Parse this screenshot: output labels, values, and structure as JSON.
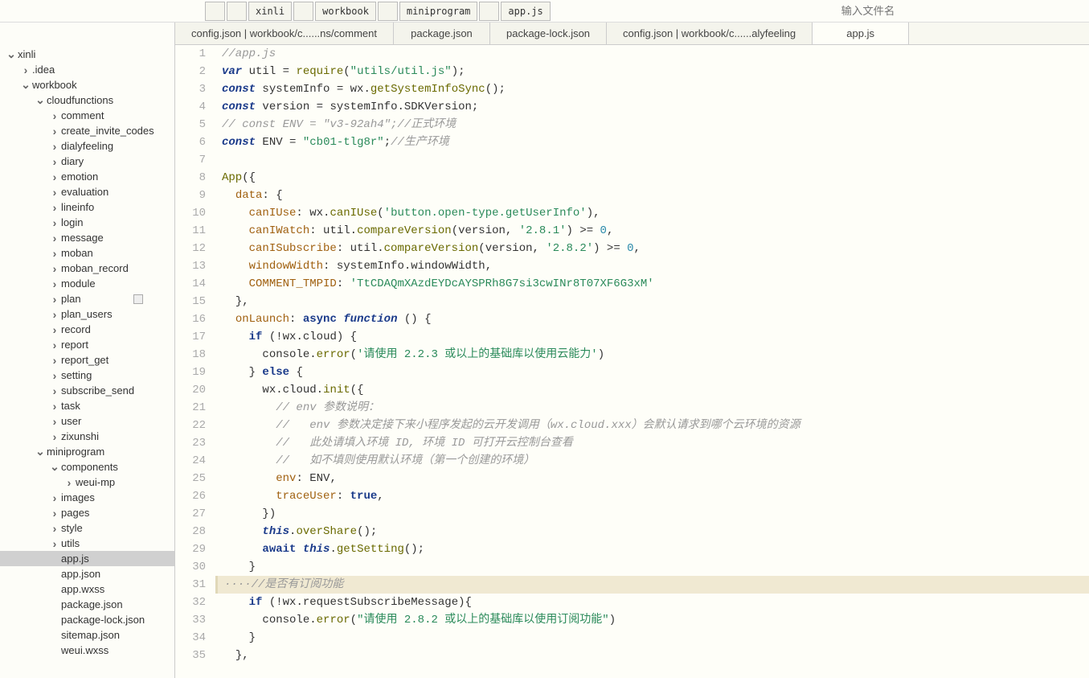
{
  "breadcrumbs": [
    {
      "label": ""
    },
    {
      "label": ""
    },
    {
      "label": "xinli"
    },
    {
      "label": ""
    },
    {
      "label": "workbook"
    },
    {
      "label": ""
    },
    {
      "label": "miniprogram"
    },
    {
      "label": ""
    },
    {
      "label": "app.js"
    }
  ],
  "search_placeholder": "输入文件名",
  "tabs": [
    {
      "label": "config.json | workbook/c......ns/comment",
      "active": false
    },
    {
      "label": "package.json",
      "active": false
    },
    {
      "label": "package-lock.json",
      "active": false
    },
    {
      "label": "config.json | workbook/c......alyfeeling",
      "active": false
    },
    {
      "label": "app.js",
      "active": true
    }
  ],
  "tree": [
    {
      "label": "xinli",
      "depth": 0,
      "arrow": "expanded"
    },
    {
      "label": ".idea",
      "depth": 1,
      "arrow": "collapsed"
    },
    {
      "label": "workbook",
      "depth": 1,
      "arrow": "expanded"
    },
    {
      "label": "cloudfunctions",
      "depth": 2,
      "arrow": "expanded"
    },
    {
      "label": "comment",
      "depth": 3,
      "arrow": "collapsed"
    },
    {
      "label": "create_invite_codes",
      "depth": 3,
      "arrow": "collapsed"
    },
    {
      "label": "dialyfeeling",
      "depth": 3,
      "arrow": "collapsed"
    },
    {
      "label": "diary",
      "depth": 3,
      "arrow": "collapsed"
    },
    {
      "label": "emotion",
      "depth": 3,
      "arrow": "collapsed"
    },
    {
      "label": "evaluation",
      "depth": 3,
      "arrow": "collapsed"
    },
    {
      "label": "lineinfo",
      "depth": 3,
      "arrow": "collapsed"
    },
    {
      "label": "login",
      "depth": 3,
      "arrow": "collapsed"
    },
    {
      "label": "message",
      "depth": 3,
      "arrow": "collapsed"
    },
    {
      "label": "moban",
      "depth": 3,
      "arrow": "collapsed"
    },
    {
      "label": "moban_record",
      "depth": 3,
      "arrow": "collapsed"
    },
    {
      "label": "module",
      "depth": 3,
      "arrow": "collapsed"
    },
    {
      "label": "plan",
      "depth": 3,
      "arrow": "collapsed",
      "badge": true
    },
    {
      "label": "plan_users",
      "depth": 3,
      "arrow": "collapsed"
    },
    {
      "label": "record",
      "depth": 3,
      "arrow": "collapsed"
    },
    {
      "label": "report",
      "depth": 3,
      "arrow": "collapsed"
    },
    {
      "label": "report_get",
      "depth": 3,
      "arrow": "collapsed"
    },
    {
      "label": "setting",
      "depth": 3,
      "arrow": "collapsed"
    },
    {
      "label": "subscribe_send",
      "depth": 3,
      "arrow": "collapsed"
    },
    {
      "label": "task",
      "depth": 3,
      "arrow": "collapsed"
    },
    {
      "label": "user",
      "depth": 3,
      "arrow": "collapsed"
    },
    {
      "label": "zixunshi",
      "depth": 3,
      "arrow": "collapsed"
    },
    {
      "label": "miniprogram",
      "depth": 2,
      "arrow": "expanded"
    },
    {
      "label": "components",
      "depth": 3,
      "arrow": "expanded"
    },
    {
      "label": "weui-mp",
      "depth": 4,
      "arrow": "collapsed"
    },
    {
      "label": "images",
      "depth": 3,
      "arrow": "collapsed"
    },
    {
      "label": "pages",
      "depth": 3,
      "arrow": "collapsed"
    },
    {
      "label": "style",
      "depth": 3,
      "arrow": "collapsed"
    },
    {
      "label": "utils",
      "depth": 3,
      "arrow": "collapsed"
    },
    {
      "label": "app.js",
      "depth": 3,
      "arrow": "none",
      "selected": true
    },
    {
      "label": "app.json",
      "depth": 3,
      "arrow": "none"
    },
    {
      "label": "app.wxss",
      "depth": 3,
      "arrow": "none"
    },
    {
      "label": "package.json",
      "depth": 3,
      "arrow": "none"
    },
    {
      "label": "package-lock.json",
      "depth": 3,
      "arrow": "none"
    },
    {
      "label": "sitemap.json",
      "depth": 3,
      "arrow": "none"
    },
    {
      "label": "weui.wxss",
      "depth": 3,
      "arrow": "none"
    }
  ],
  "code": [
    {
      "n": 1,
      "html": "<span class='cm'>//app.js</span>"
    },
    {
      "n": 2,
      "html": "<span class='kw'>var</span> <span class='id'>util</span> <span class='pn'>=</span> <span class='fn'>require</span><span class='pn'>(</span><span class='str'>\"utils/util.js\"</span><span class='pn'>);</span>"
    },
    {
      "n": 3,
      "html": "<span class='kw'>const</span> <span class='id'>systemInfo</span> <span class='pn'>=</span> <span class='id'>wx</span><span class='pn'>.</span><span class='fn'>getSystemInfoSync</span><span class='pn'>();</span>"
    },
    {
      "n": 4,
      "html": "<span class='kw'>const</span> <span class='id'>version</span> <span class='pn'>=</span> <span class='id'>systemInfo</span><span class='pn'>.</span><span class='id'>SDKVersion</span><span class='pn'>;</span>"
    },
    {
      "n": 5,
      "html": "<span class='cm'>// const ENV = \"v3-92ah4\";//正式环境</span>"
    },
    {
      "n": 6,
      "html": "<span class='kw'>const</span> <span class='id'>ENV</span> <span class='pn'>=</span> <span class='str'>\"cb01-tlg8r\"</span><span class='pn'>;</span><span class='cm'>//生产环境</span>"
    },
    {
      "n": 7,
      "html": ""
    },
    {
      "n": 8,
      "html": "<span class='fn'>App</span><span class='pn'>({</span>"
    },
    {
      "n": 9,
      "html": "  <span class='prop'>data</span><span class='pn'>: {</span>"
    },
    {
      "n": 10,
      "html": "    <span class='prop'>canIUse</span><span class='pn'>:</span> <span class='id'>wx</span><span class='pn'>.</span><span class='fn'>canIUse</span><span class='pn'>(</span><span class='str'>'button.open-type.getUserInfo'</span><span class='pn'>),</span>"
    },
    {
      "n": 11,
      "html": "    <span class='prop'>canIWatch</span><span class='pn'>:</span> <span class='id'>util</span><span class='pn'>.</span><span class='fn'>compareVersion</span><span class='pn'>(</span><span class='id'>version</span><span class='pn'>,</span> <span class='str'>'2.8.1'</span><span class='pn'>) &gt;=</span> <span class='num'>0</span><span class='pn'>,</span>"
    },
    {
      "n": 12,
      "html": "    <span class='prop'>canISubscribe</span><span class='pn'>:</span> <span class='id'>util</span><span class='pn'>.</span><span class='fn'>compareVersion</span><span class='pn'>(</span><span class='id'>version</span><span class='pn'>,</span> <span class='str'>'2.8.2'</span><span class='pn'>) &gt;=</span> <span class='num'>0</span><span class='pn'>,</span>"
    },
    {
      "n": 13,
      "html": "    <span class='prop'>windowWidth</span><span class='pn'>:</span> <span class='id'>systemInfo</span><span class='pn'>.</span><span class='id'>windowWidth</span><span class='pn'>,</span>"
    },
    {
      "n": 14,
      "html": "    <span class='prop'>COMMENT_TMPID</span><span class='pn'>:</span> <span class='str'>'TtCDAQmXAzdEYDcAYSPRh8G7si3cwINr8T07XF6G3xM'</span>"
    },
    {
      "n": 15,
      "html": "  <span class='pn'>},</span>"
    },
    {
      "n": 16,
      "html": "  <span class='prop'>onLaunch</span><span class='pn'>:</span> <span class='kw2'>async</span> <span class='kw'>function</span> <span class='pn'>() {</span>"
    },
    {
      "n": 17,
      "html": "    <span class='kw2'>if</span> <span class='pn'>(!</span><span class='id'>wx</span><span class='pn'>.</span><span class='id'>cloud</span><span class='pn'>) {</span>"
    },
    {
      "n": 18,
      "html": "      <span class='id'>console</span><span class='pn'>.</span><span class='fn'>error</span><span class='pn'>(</span><span class='str'>'请使用 2.2.3 或以上的基础库以使用云能力'</span><span class='pn'>)</span>"
    },
    {
      "n": 19,
      "html": "    <span class='pn'>}</span> <span class='kw2'>else</span> <span class='pn'>{</span>"
    },
    {
      "n": 20,
      "html": "      <span class='id'>wx</span><span class='pn'>.</span><span class='id'>cloud</span><span class='pn'>.</span><span class='fn'>init</span><span class='pn'>({</span>"
    },
    {
      "n": 21,
      "html": "        <span class='cm'>// env 参数说明：</span>"
    },
    {
      "n": 22,
      "html": "        <span class='cm'>//   env 参数决定接下来小程序发起的云开发调用（wx.cloud.xxx）会默认请求到哪个云环境的资源</span>"
    },
    {
      "n": 23,
      "html": "        <span class='cm'>//   此处请填入环境 ID, 环境 ID 可打开云控制台查看</span>"
    },
    {
      "n": 24,
      "html": "        <span class='cm'>//   如不填则使用默认环境（第一个创建的环境）</span>"
    },
    {
      "n": 25,
      "html": "        <span class='prop'>env</span><span class='pn'>:</span> <span class='id'>ENV</span><span class='pn'>,</span>"
    },
    {
      "n": 26,
      "html": "        <span class='prop'>traceUser</span><span class='pn'>:</span> <span class='bool'>true</span><span class='pn'>,</span>"
    },
    {
      "n": 27,
      "html": "      <span class='pn'>})</span>"
    },
    {
      "n": 28,
      "html": "      <span class='kw'>this</span><span class='pn'>.</span><span class='fn'>overShare</span><span class='pn'>();</span>"
    },
    {
      "n": 29,
      "html": "      <span class='kw2'>await</span> <span class='kw'>this</span><span class='pn'>.</span><span class='fn'>getSetting</span><span class='pn'>();</span>"
    },
    {
      "n": 30,
      "html": "    <span class='pn'>}</span>"
    },
    {
      "n": 31,
      "html": "<span class='cm'>····//是否有订阅功能</span>",
      "hl": true
    },
    {
      "n": 32,
      "html": "    <span class='kw2'>if</span> <span class='pn'>(!</span><span class='id'>wx</span><span class='pn'>.</span><span class='id'>requestSubscribeMessage</span><span class='pn'>){</span>"
    },
    {
      "n": 33,
      "html": "      <span class='id'>console</span><span class='pn'>.</span><span class='fn'>error</span><span class='pn'>(</span><span class='str'>\"请使用 2.8.2 或以上的基础库以使用订阅功能\"</span><span class='pn'>)</span>"
    },
    {
      "n": 34,
      "html": "    <span class='pn'>}</span>"
    },
    {
      "n": 35,
      "html": "  <span class='pn'>},</span>"
    }
  ]
}
